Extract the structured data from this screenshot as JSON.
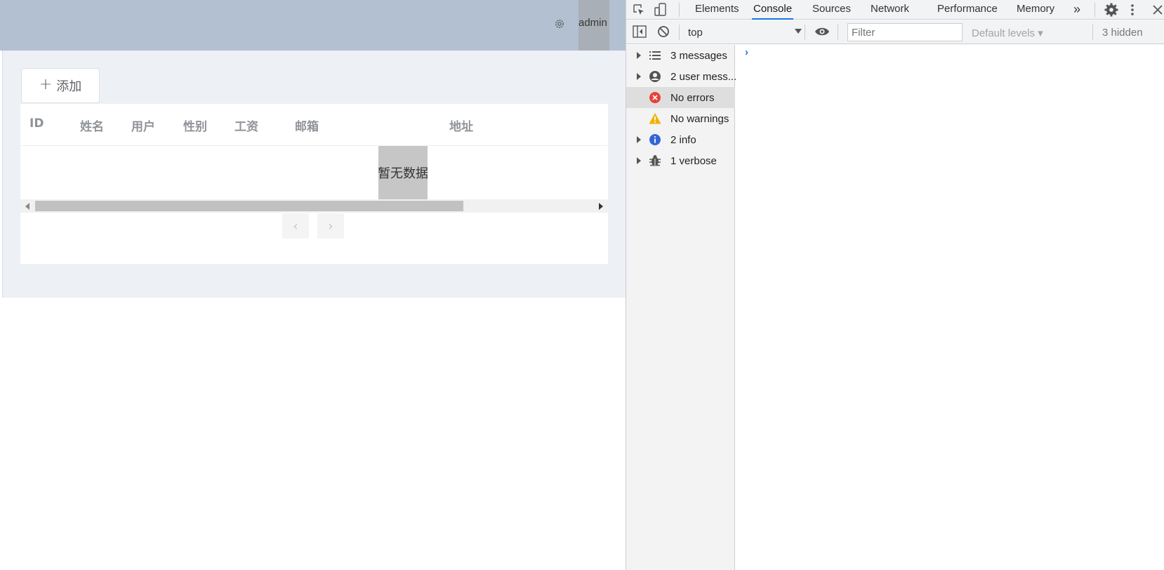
{
  "app": {
    "header": {
      "username": "admin",
      "settings_icon": "gear-icon"
    },
    "add_button": {
      "icon": "plus-icon",
      "label": "添加"
    },
    "table": {
      "columns": [
        "ID",
        "姓名",
        "用户",
        "性别",
        "工资",
        "邮箱",
        "地址"
      ],
      "empty_text": "暂无数据"
    },
    "pagination": {
      "prev": "‹",
      "next": "›"
    }
  },
  "devtools": {
    "tabs": [
      "Elements",
      "Console",
      "Sources",
      "Network",
      "Performance",
      "Memory"
    ],
    "active_tab": "Console",
    "more_tabs": "»",
    "toolbar": {
      "context": "top",
      "filter_placeholder": "Filter",
      "levels": "Default levels ▾",
      "hidden": "3 hidden"
    },
    "sidebar": [
      {
        "label": "3 messages",
        "icon": "list-icon",
        "expandable": true
      },
      {
        "label": "2 user mess...",
        "icon": "user-icon",
        "expandable": true
      },
      {
        "label": "No errors",
        "icon": "error-icon",
        "expandable": false,
        "selected": true
      },
      {
        "label": "No warnings",
        "icon": "warning-icon",
        "expandable": false
      },
      {
        "label": "2 info",
        "icon": "info-icon",
        "expandable": true
      },
      {
        "label": "1 verbose",
        "icon": "bug-icon",
        "expandable": true
      }
    ],
    "prompt": "›",
    "colors": {
      "accent": "#1a73e8",
      "error": "#e8413a",
      "warning": "#f2b100",
      "info": "#3367d6"
    }
  }
}
